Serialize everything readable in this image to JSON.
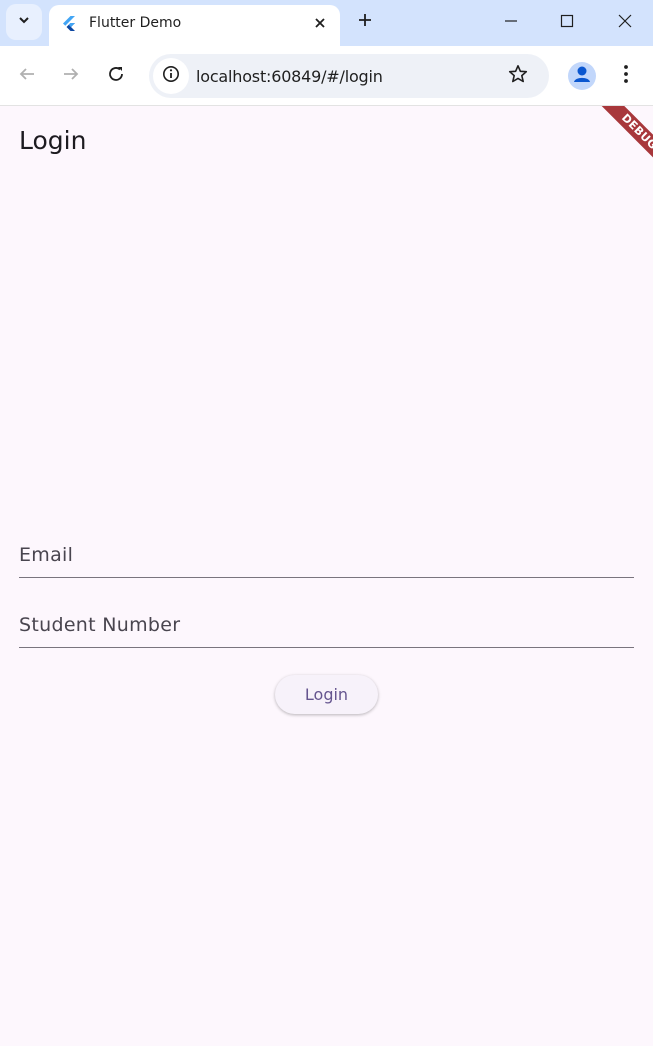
{
  "browser": {
    "tab_title": "Flutter Demo",
    "url": "localhost:60849/#/login",
    "icons": [
      "tab-search-icon",
      "flutter-logo-icon",
      "close-icon",
      "plus-icon",
      "minimize-icon",
      "maximize-icon",
      "window-close-icon",
      "back-arrow-icon",
      "forward-arrow-icon",
      "reload-icon",
      "site-info-icon",
      "star-icon",
      "profile-icon",
      "kebab-menu-icon"
    ]
  },
  "app": {
    "title": "Login",
    "debug_banner": "DEBUG",
    "fields": {
      "email_label": "Email",
      "student_number_label": "Student Number"
    },
    "login_button": "Login"
  },
  "colors": {
    "tabstrip": "#d3e3fd",
    "page_background": "#fdf7fd",
    "debug_banner": "#a8373b",
    "button_text": "#65558f"
  }
}
